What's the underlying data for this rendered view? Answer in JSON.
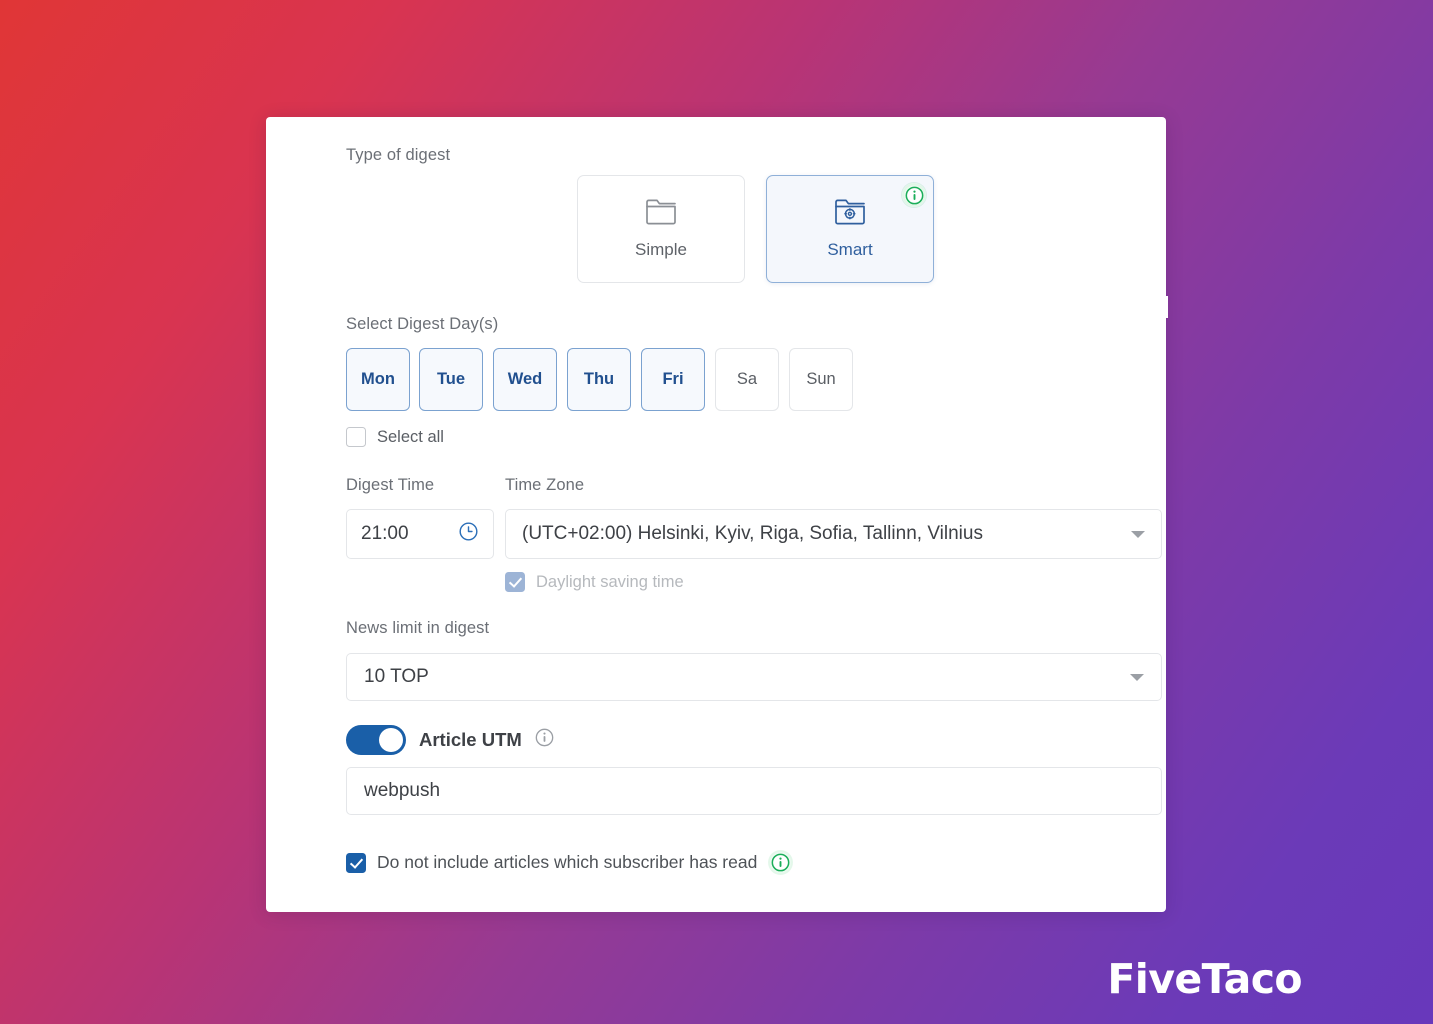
{
  "form": {
    "type_of_digest": {
      "label": "Type of digest",
      "options": [
        {
          "id": "simple",
          "label": "Simple",
          "icon": "folder-icon",
          "selected": false
        },
        {
          "id": "smart",
          "label": "Smart",
          "icon": "folder-gear-icon",
          "selected": true,
          "info_icon": "info-icon"
        }
      ]
    },
    "digest_days": {
      "label": "Select Digest Day(s)",
      "days": [
        {
          "label": "Mon",
          "selected": true
        },
        {
          "label": "Tue",
          "selected": true
        },
        {
          "label": "Wed",
          "selected": true
        },
        {
          "label": "Thu",
          "selected": true
        },
        {
          "label": "Fri",
          "selected": true
        },
        {
          "label": "Sa",
          "selected": false
        },
        {
          "label": "Sun",
          "selected": false
        }
      ],
      "select_all_label": "Select all",
      "select_all_checked": false
    },
    "digest_time": {
      "label": "Digest Time",
      "value": "21:00",
      "icon": "clock-icon"
    },
    "time_zone": {
      "label": "Time Zone",
      "value": "(UTC+02:00) Helsinki, Kyiv, Riga, Sofia, Tallinn, Vilnius",
      "daylight_saving_label": "Daylight saving time",
      "daylight_saving_checked": true,
      "daylight_saving_disabled": true
    },
    "news_limit": {
      "label": "News limit in digest",
      "value": "10 TOP"
    },
    "article_utm": {
      "label": "Article UTM",
      "enabled": true,
      "info_icon": "info-icon",
      "value": "webpush"
    },
    "exclude_read": {
      "label": "Do not include articles which subscriber has read",
      "checked": true,
      "info_icon": "info-icon"
    }
  },
  "watermark": {
    "text": "FiveTaco"
  },
  "colors": {
    "accent_blue": "#1a5fa8",
    "selected_card_bg": "#f4f7fc",
    "selected_card_border": "#8fb0d8",
    "day_selected_text": "#21508f",
    "info_green": "#1bae5a",
    "label_grey": "#6b6f76",
    "bg_gradient_start": "#e03636",
    "bg_gradient_mid": "#963a93",
    "bg_gradient_end": "#6838bb"
  }
}
